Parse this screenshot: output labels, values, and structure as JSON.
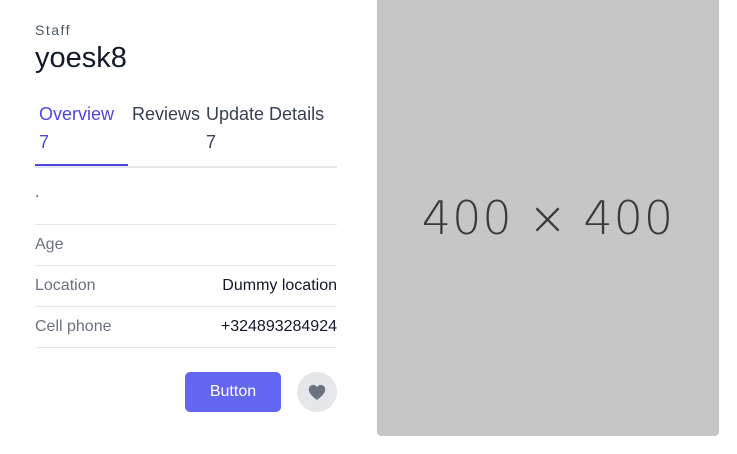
{
  "header": {
    "eyebrow": "Staff",
    "title": "yoesk8"
  },
  "tabs": [
    {
      "label": "Overview",
      "count": "7",
      "active": true
    },
    {
      "label": "Reviews",
      "count": "",
      "active": false
    },
    {
      "label": "Update Details",
      "count": "7",
      "active": false
    }
  ],
  "description": ".",
  "details": [
    {
      "label": "Age",
      "value": ""
    },
    {
      "label": "Location",
      "value": "Dummy location"
    },
    {
      "label": "Cell phone",
      "value": "+324893284924"
    }
  ],
  "actions": {
    "button_label": "Button",
    "favorite_icon": "heart-icon"
  },
  "image": {
    "placeholder_text": "400 × 400"
  },
  "colors": {
    "accent": "#6366f1",
    "active_tab": "#4f46e5",
    "placeholder_bg": "#c6c6c6"
  }
}
